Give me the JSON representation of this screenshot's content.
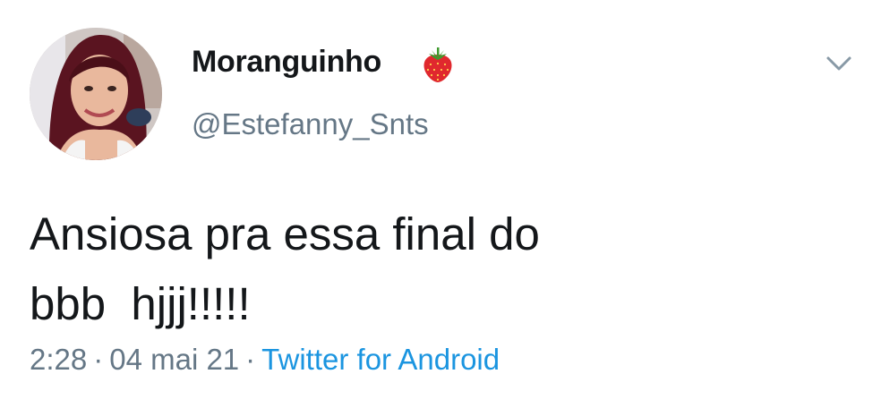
{
  "tweet": {
    "display_name": "Moranguinho",
    "name_emoji": "strawberry-emoji",
    "handle": "@Estefanny_Snts",
    "text": "Ansiosa pra essa final do\nbbb  hjjj!!!!!",
    "time": "2:28",
    "separator": "·",
    "date": "04 mai 21",
    "source": "Twitter for Android",
    "menu_icon": "chevron-down-icon"
  },
  "colors": {
    "text_primary": "#14171a",
    "text_secondary": "#657786",
    "link": "#1b95e0",
    "background": "#ffffff"
  }
}
